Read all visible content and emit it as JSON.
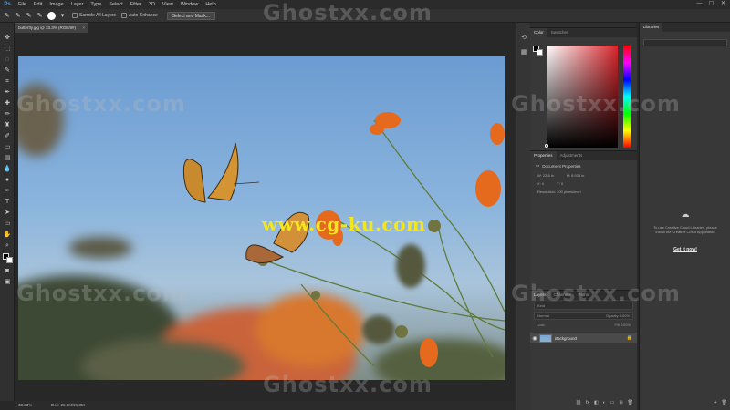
{
  "app": {
    "logo": "Ps"
  },
  "menu": [
    "File",
    "Edit",
    "Image",
    "Layer",
    "Type",
    "Select",
    "Filter",
    "3D",
    "View",
    "Window",
    "Help"
  ],
  "window_controls": [
    "—",
    "▢",
    "✕"
  ],
  "options": {
    "sample_all_layers": "Sample All Layers",
    "auto_enhance": "Auto-Enhance",
    "select_and_mask": "Select and Mask..."
  },
  "document": {
    "tab_title": "butterfly.jpg @ 33.3% (RGB/8#)",
    "close": "×"
  },
  "statusbar": {
    "zoom": "33.33%",
    "doc_size": "Doc: 26.3M/26.3M"
  },
  "overlay": {
    "url_watermark": "www.cg-ku.com",
    "ghost_watermark": "Ghostxx.com"
  },
  "panels": {
    "color": {
      "tabs": [
        "Color",
        "Swatches"
      ]
    },
    "properties": {
      "tabs": [
        "Properties",
        "Adjustments"
      ],
      "layer_label": "Document Properties",
      "w_label": "W:",
      "w_value": "22.8 in",
      "h_label": "H:",
      "h_value": "8.933 in",
      "x_label": "X:",
      "x_value": "0",
      "y_label": "Y:",
      "y_value": "0",
      "resolution": "Resolution: 300 pixels/inch"
    },
    "layers": {
      "tabs": [
        "Layers",
        "Channels",
        "Paths"
      ],
      "kind": "Kind",
      "blend_mode": "Normal",
      "opacity": "Opacity: 100%",
      "lock": "Lock:",
      "fill": "Fill: 100%",
      "layer_name": "Background"
    },
    "libraries": {
      "tab": "Libraries",
      "message": "To use Creative Cloud Libraries, please install the Creative Cloud Application",
      "link": "Get it now!"
    }
  }
}
